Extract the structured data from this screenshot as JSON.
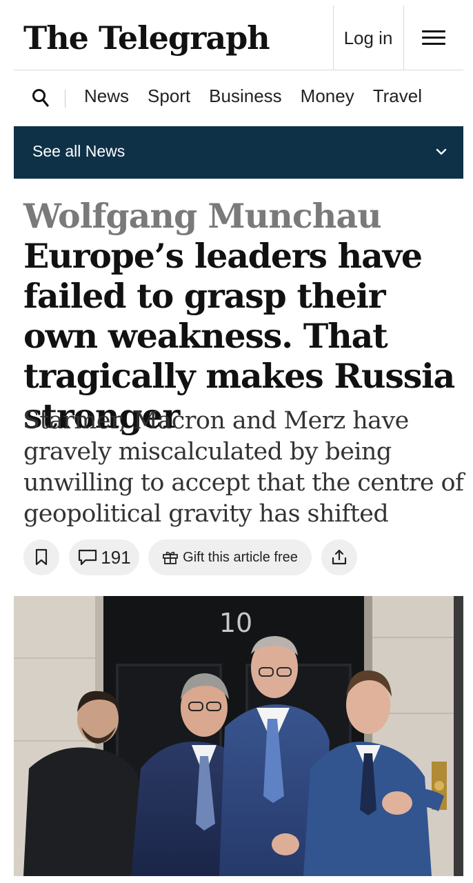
{
  "header": {
    "logo_text": "The Telegraph",
    "login_label": "Log in",
    "menu_icon": "hamburger-icon"
  },
  "nav": {
    "search_icon": "search-icon",
    "items": [
      {
        "label": "News"
      },
      {
        "label": "Sport"
      },
      {
        "label": "Business"
      },
      {
        "label": "Money"
      },
      {
        "label": "Travel"
      }
    ]
  },
  "section_bar": {
    "label": "See all News",
    "icon": "chevron-down-icon"
  },
  "article": {
    "author": "Wolfgang Munchau",
    "headline": "Europe’s leaders have failed to grasp their own weakness. That tragically makes Russia stronger",
    "standfirst": "Starmer, Macron and Merz have gravely miscalculated by being unwilling to accept that the centre of geopolitical gravity has shifted"
  },
  "actions": {
    "bookmark_icon": "bookmark-icon",
    "comment_icon": "comment-icon",
    "comment_count": "191",
    "gift_icon": "gift-icon",
    "gift_label": "Gift this article free",
    "share_icon": "share-icon"
  },
  "photo": {
    "door_number": "10"
  },
  "colors": {
    "section_bar_bg": "#0f3148",
    "pill_bg": "#efefef",
    "author_grey": "#7a7a7a"
  }
}
